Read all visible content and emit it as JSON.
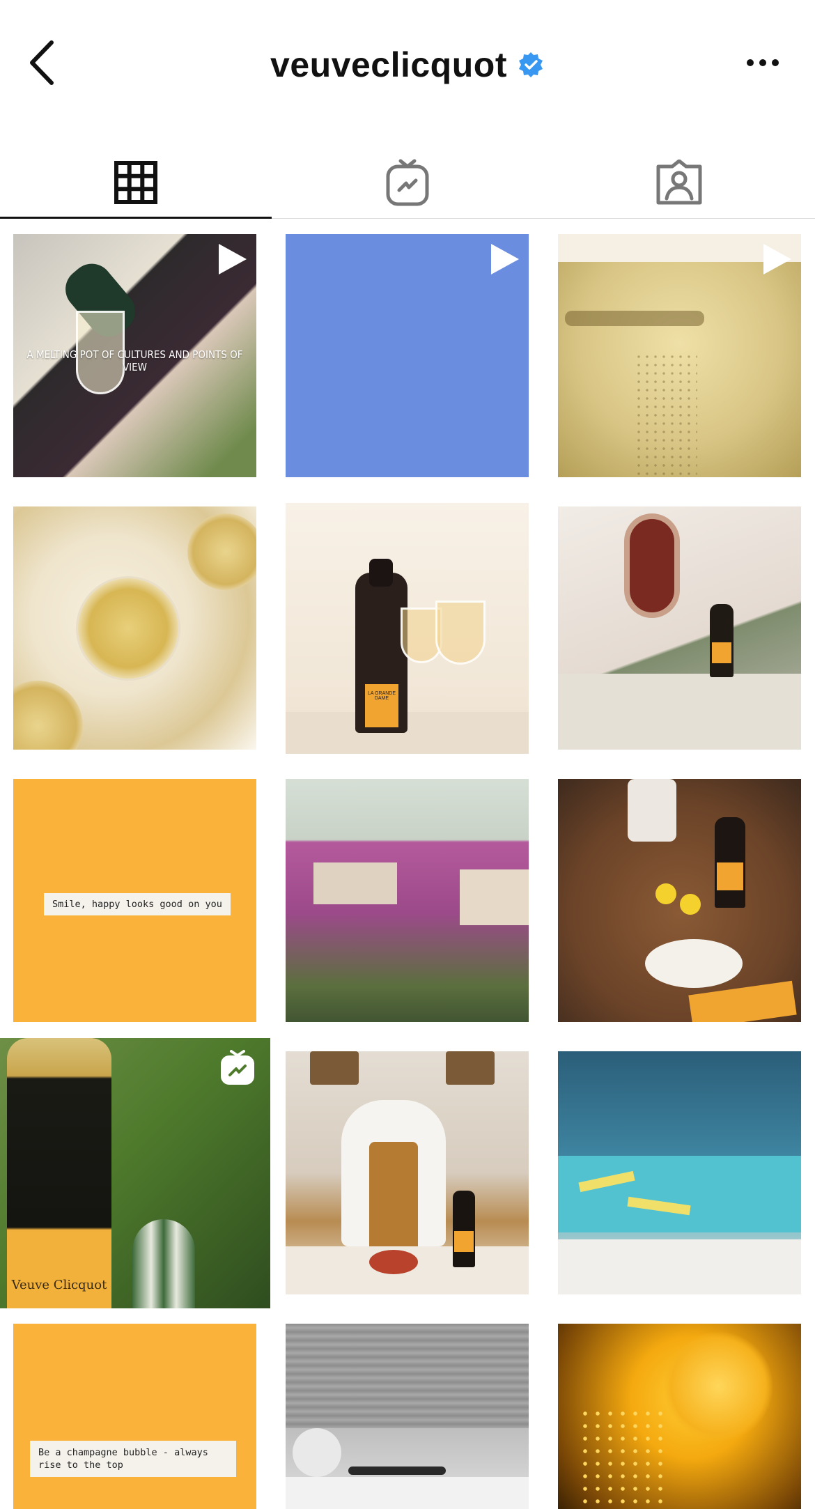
{
  "header": {
    "username": "veuveclicquot",
    "verified_icon": "verified-badge-icon",
    "back_icon": "chevron-left-icon",
    "more_icon": "more-horizontal-icon"
  },
  "tabs": [
    {
      "name": "posts",
      "icon": "grid-icon",
      "active": true
    },
    {
      "name": "igtv",
      "icon": "igtv-icon",
      "active": false
    },
    {
      "name": "tagged",
      "icon": "tagged-user-icon",
      "active": false
    }
  ],
  "grid": [
    {
      "kind": "video",
      "overlay_text": "A MELTING POT OF CULTURES AND POINTS OF VIEW"
    },
    {
      "kind": "video"
    },
    {
      "kind": "video"
    },
    {
      "kind": "photo"
    },
    {
      "kind": "photo",
      "bottle_label": "LA GRANDE DAME"
    },
    {
      "kind": "photo"
    },
    {
      "kind": "photo",
      "caption": "Smile, happy looks good on you"
    },
    {
      "kind": "photo"
    },
    {
      "kind": "photo"
    },
    {
      "kind": "reel",
      "bottle_label": "Veuve Clicquot"
    },
    {
      "kind": "photo"
    },
    {
      "kind": "photo"
    },
    {
      "kind": "photo",
      "caption": "Be a champagne bubble - always rise to the top"
    },
    {
      "kind": "photo"
    },
    {
      "kind": "photo"
    }
  ],
  "colors": {
    "brand_yellow": "#fbb23a",
    "verified_blue": "#3897f0",
    "divider": "#dbdbdb"
  }
}
